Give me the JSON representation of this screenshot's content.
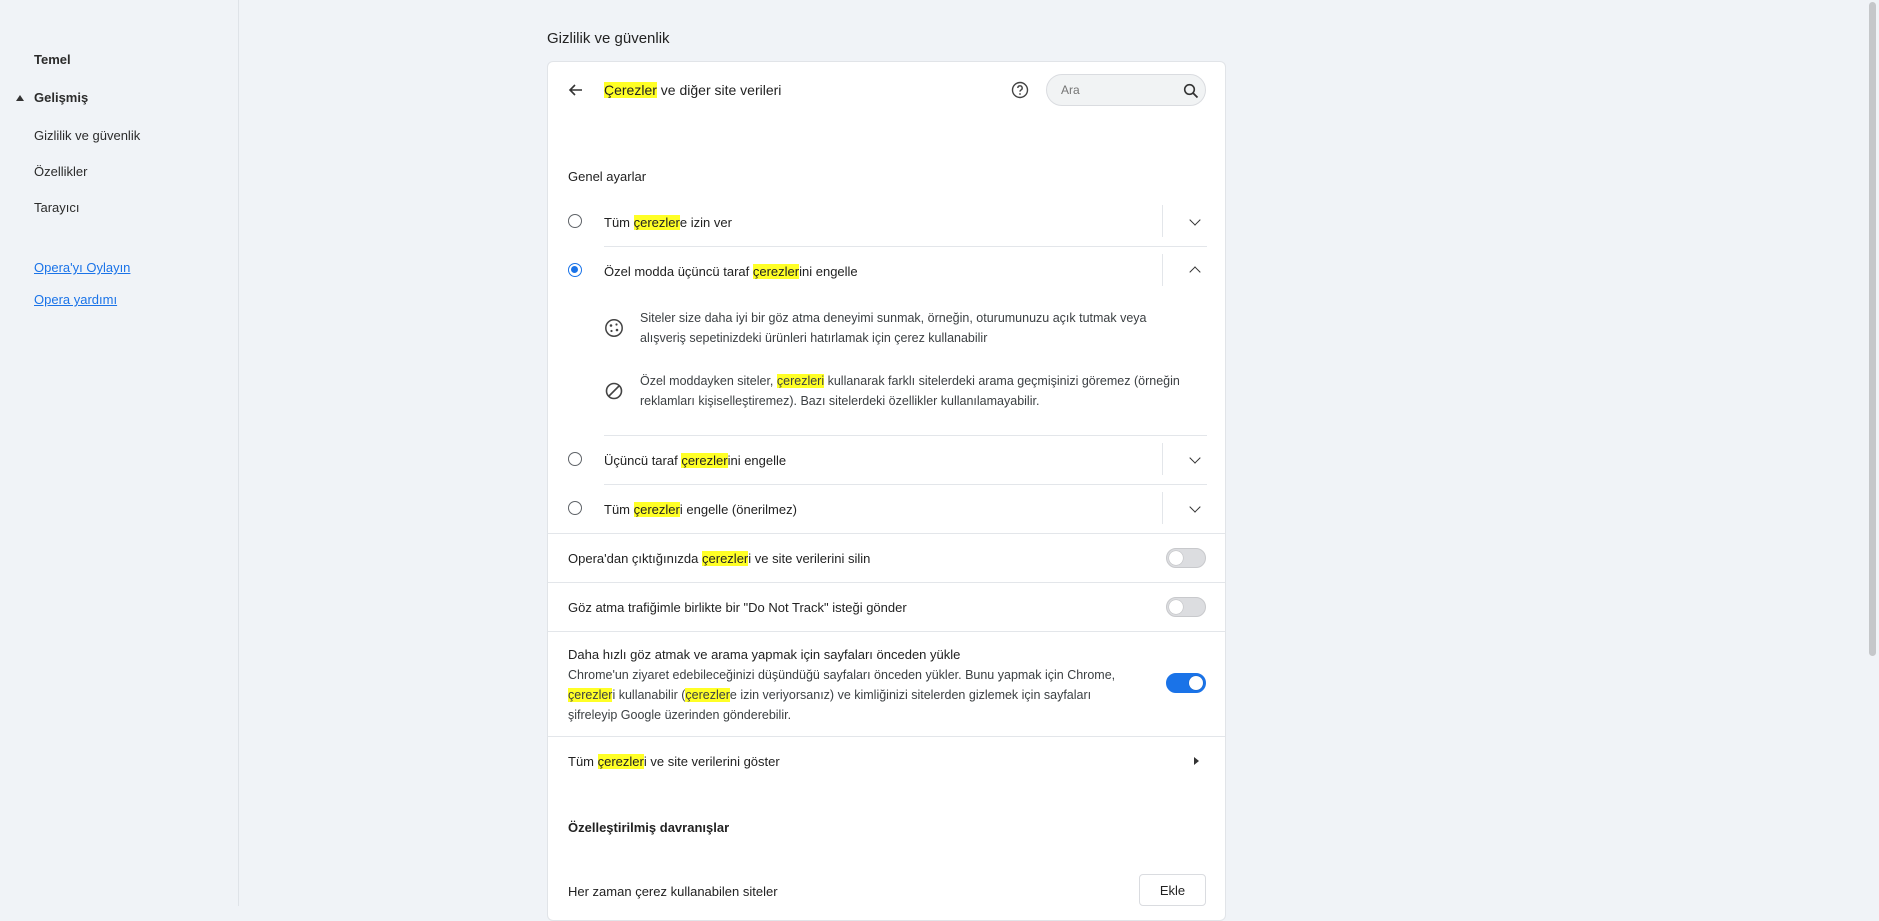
{
  "sidebar": {
    "items": [
      {
        "label": "Temel"
      },
      {
        "label": "Gelişmiş"
      },
      {
        "label": "Gizlilik ve güvenlik"
      },
      {
        "label": "Özellikler"
      },
      {
        "label": "Tarayıcı"
      }
    ],
    "links": [
      {
        "label": "Opera'yı Oylayın"
      },
      {
        "label": "Opera yardımı"
      }
    ]
  },
  "section_title": "Gizlilik ve güvenlik",
  "header": {
    "title_highlight": "Çerezler",
    "title_rest": " ve diğer site verileri",
    "search_placeholder": "Ara"
  },
  "general": {
    "heading": "Genel ayarlar",
    "options": [
      {
        "pre": "Tüm ",
        "hl": "çerezler",
        "post": "e izin ver",
        "selected": false
      },
      {
        "pre": "Özel modda üçüncü taraf ",
        "hl": "çerezler",
        "post": "ini engelle",
        "selected": true
      },
      {
        "pre": "Üçüncü taraf ",
        "hl": "çerezler",
        "post": "ini engelle",
        "selected": false
      },
      {
        "pre": "Tüm ",
        "hl": "çerezler",
        "post": "i engelle (önerilmez)",
        "selected": false
      }
    ],
    "expanded": {
      "desc1_line1": "Siteler size daha iyi bir göz atma deneyimi sunmak, örneğin, oturumunuzu açık tutmak veya",
      "desc1_line2": "alışveriş sepetinizdeki ürünleri hatırlamak için çerez kullanabilir",
      "desc2_pre": "Özel moddayken siteler, ",
      "desc2_hl": "çerezleri",
      "desc2_post": " kullanarak farklı sitelerdeki arama geçmişinizi göremez (örneğin",
      "desc2_line2": "reklamları kişiselleştiremez). Bazı sitelerdeki özellikler kullanılamayabilir."
    }
  },
  "toggles": [
    {
      "pre": "Opera'dan çıktığınızda ",
      "hl": "çerezler",
      "post": "i ve site verilerini silin",
      "on": false
    },
    {
      "label": "Göz atma trafiğimle birlikte bir \"Do Not Track\" isteği gönder",
      "on": false
    }
  ],
  "preload": {
    "title": "Daha hızlı göz atmak ve arama yapmak için sayfaları önceden yükle",
    "line1": "Chrome'un ziyaret edebileceğinizi düşündüğü sayfaları önceden yükler. Bunu yapmak için Chrome,",
    "line2_hl1": "çerezler",
    "line2_mid1": "i kullanabilir (",
    "line2_hl2": "çerezler",
    "line2_post": "e izin veriyorsanız) ve kimliğinizi sitelerden gizlemek için sayfaları",
    "line3": "şifreleyip Google üzerinden gönderebilir.",
    "on": true
  },
  "all_cookies": {
    "pre": "Tüm ",
    "hl": "çerezler",
    "post": "i ve site verilerini göster"
  },
  "custom": {
    "heading": "Özelleştirilmiş davranışlar",
    "always_allowed": "Her zaman çerez kullanabilen siteler",
    "add_button": "Ekle"
  },
  "colors": {
    "accent": "#1a73e8",
    "highlight": "#ffff26",
    "background": "#f0f3f7"
  }
}
